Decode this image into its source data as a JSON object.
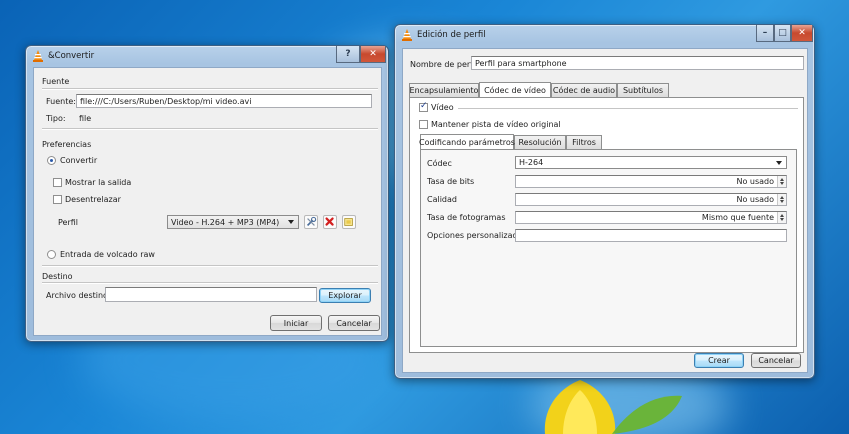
{
  "convert_window": {
    "title": "&Convertir",
    "help_label": "?",
    "close_label": "✕",
    "source": {
      "group": "Fuente",
      "source_label": "Fuente:",
      "source_value": "file:///C:/Users/Ruben/Desktop/mi video.avi",
      "type_label": "Tipo:",
      "type_value": "file"
    },
    "preferences": {
      "group": "Preferencias",
      "convert_label": "Convertir",
      "show_output_label": "Mostrar la salida",
      "deinterlace_label": "Desentrelazar",
      "profile_label": "Perfil",
      "profile_value": "Video - H.264 + MP3 (MP4)",
      "raw_dump_label": "Entrada de volcado raw"
    },
    "destination": {
      "group": "Destino",
      "file_label": "Archivo destino:",
      "file_value": "",
      "browse_label": "Explorar"
    },
    "start_label": "Iniciar",
    "cancel_label": "Cancelar"
  },
  "profile_window": {
    "title": "Edición de perfil",
    "min_label": "–",
    "max_label": "□",
    "close_label": "✕",
    "name_label": "Nombre de perfil",
    "name_value": "Perfil para smartphone",
    "tabs": [
      "Encapsulamiento",
      "Códec de vídeo",
      "Códec de audio",
      "Subtítulos"
    ],
    "video_checkbox": "Vídeo",
    "keep_track_label": "Mantener pista de vídeo original",
    "subtabs": [
      "Codificando parámetros",
      "Resolución",
      "Filtros"
    ],
    "codec_label": "Códec",
    "codec_value": "H-264",
    "bitrate_label": "Tasa de bits",
    "bitrate_value": "No usado",
    "quality_label": "Calidad",
    "quality_value": "No usado",
    "framerate_label": "Tasa de fotogramas",
    "framerate_value": "Mismo que fuente",
    "custom_label": "Opciones personalizadas",
    "custom_value": "",
    "create_label": "Crear",
    "cancel_label": "Cancelar"
  }
}
